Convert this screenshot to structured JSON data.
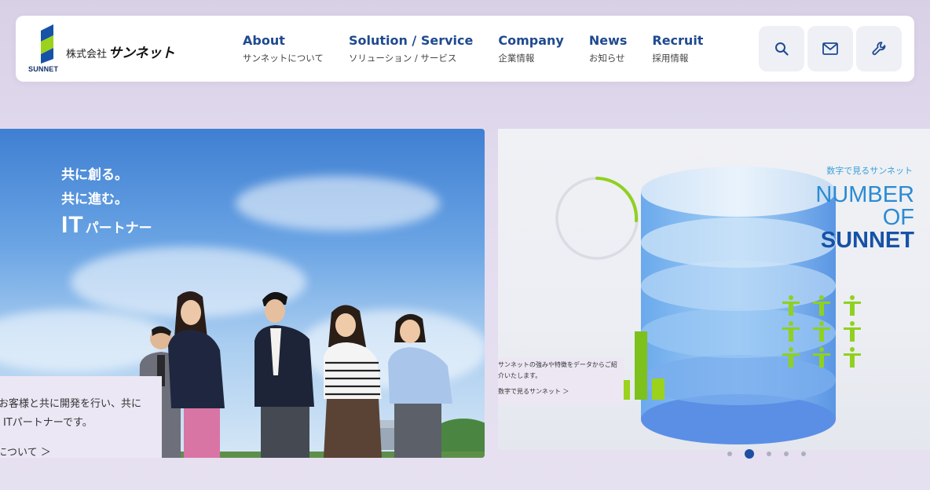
{
  "brand": {
    "logo_text_en": "SUNNET",
    "company_prefix": "株式会社",
    "company_name": "サンネット",
    "color_primary": "#1f4a8f",
    "color_logo_blue": "#1652a6",
    "color_logo_green": "#9bd21c"
  },
  "nav": {
    "items": [
      {
        "en": "About",
        "ja": "サンネットについて"
      },
      {
        "en": "Solution / Service",
        "ja": "ソリューション / サービス"
      },
      {
        "en": "Company",
        "ja": "企業情報"
      },
      {
        "en": "News",
        "ja": "お知らせ"
      },
      {
        "en": "Recruit",
        "ja": "採用情報"
      }
    ]
  },
  "header_buttons": {
    "search_icon": "search-icon",
    "mail_icon": "mail-icon",
    "tool_icon": "wrench-icon"
  },
  "hero": {
    "line1": "共に創る。",
    "line2": "共に進む。",
    "it_big": "IT",
    "it_small": "パートナー",
    "card_line1": "お客様と共に開発を行い、共に",
    "card_line2": "ITパートナーです。",
    "card_link": "について ＞"
  },
  "slide": {
    "label_jp": "数字で見るサンネット",
    "title_line1": "NUMBER",
    "title_line2": "OF",
    "title_line3": "SUNNET",
    "card_line1": "サンネットの強みや特徴をデータからご紹",
    "card_line2": "介いたします。",
    "card_link": "数字で見るサンネット ＞"
  },
  "carousel": {
    "count": 5,
    "active_index": 1
  }
}
